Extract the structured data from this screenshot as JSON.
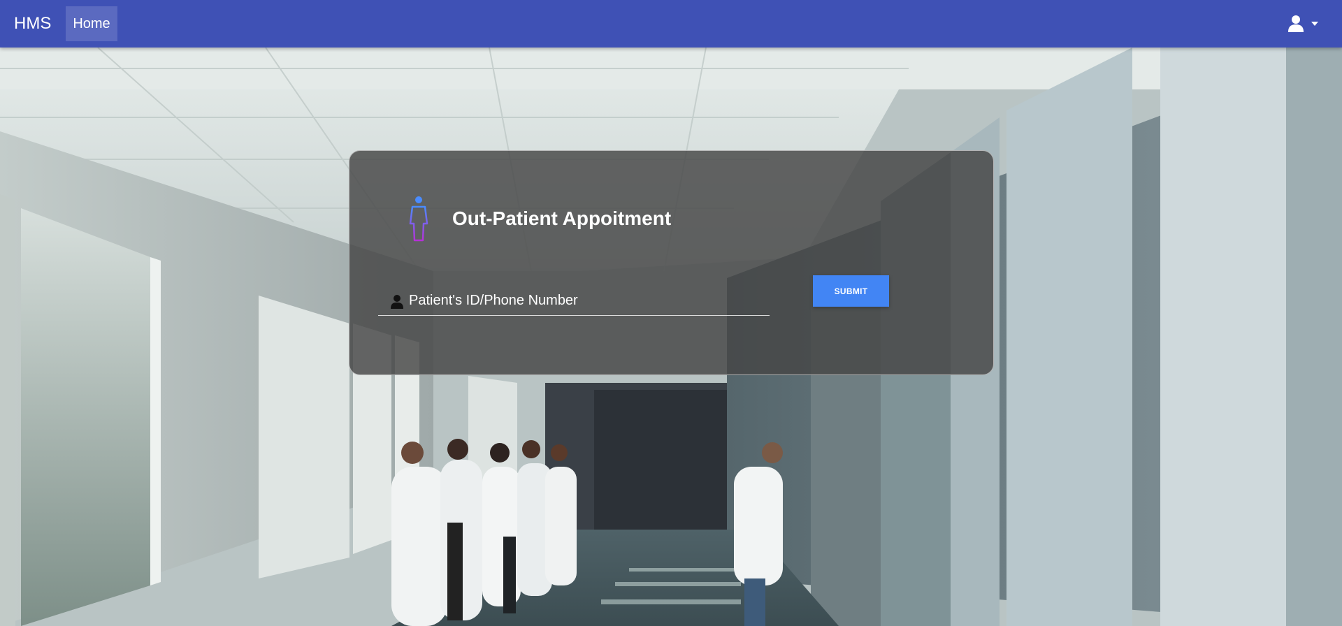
{
  "navbar": {
    "brand": "HMS",
    "home_label": "Home",
    "user_icon": "user-icon",
    "dropdown_icon": "caret-down-icon",
    "color": "#3f51b5"
  },
  "appointment": {
    "title": "Out-Patient Appoitment",
    "icon": "person-icon",
    "field": {
      "icon": "user-icon",
      "placeholder": "Patient's ID/Phone Number",
      "value": ""
    },
    "submit_label": "SUBMIT",
    "submit_color": "#4285f4"
  }
}
